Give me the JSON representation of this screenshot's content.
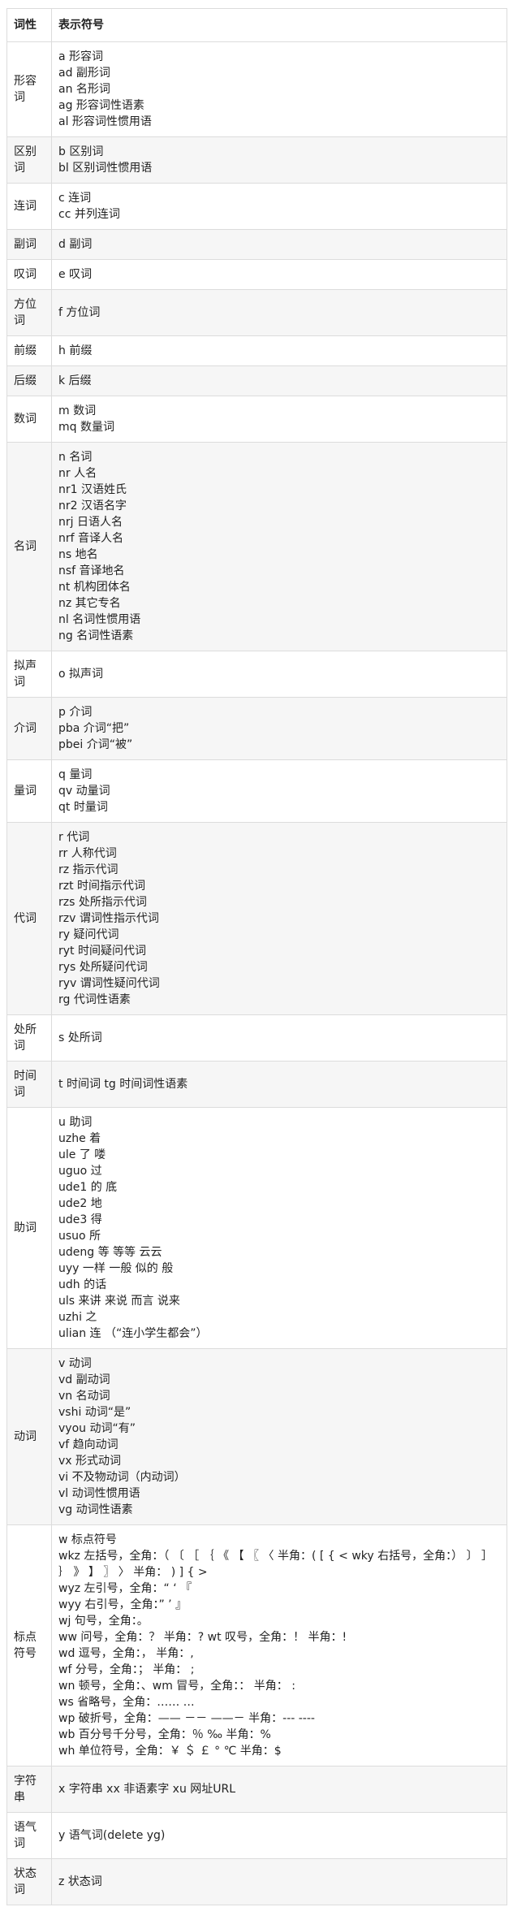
{
  "table": {
    "headers": [
      "词性",
      "表示符号"
    ],
    "rows": [
      {
        "pos": "形容词",
        "tags": [
          "a 形容词",
          "ad 副形词",
          "an 名形词",
          "ag 形容词性语素",
          "al 形容词性惯用语"
        ]
      },
      {
        "pos": "区别词",
        "tags": [
          "b 区别词",
          "bl 区别词性惯用语"
        ]
      },
      {
        "pos": "连词",
        "tags": [
          "c 连词",
          "cc 并列连词"
        ]
      },
      {
        "pos": "副词",
        "tags": [
          "d 副词"
        ]
      },
      {
        "pos": "叹词",
        "tags": [
          "e 叹词"
        ]
      },
      {
        "pos": "方位词",
        "tags": [
          "f 方位词"
        ]
      },
      {
        "pos": "前缀",
        "tags": [
          "h 前缀"
        ]
      },
      {
        "pos": "后缀",
        "tags": [
          "k 后缀"
        ]
      },
      {
        "pos": "数词",
        "tags": [
          "m 数词",
          "mq 数量词"
        ]
      },
      {
        "pos": "名词",
        "tags": [
          "n 名词",
          "nr 人名",
          "nr1 汉语姓氏",
          "nr2 汉语名字",
          "nrj 日语人名",
          "nrf 音译人名",
          "ns 地名",
          "nsf 音译地名",
          "nt 机构团体名",
          "nz 其它专名",
          "nl 名词性惯用语",
          "ng 名词性语素"
        ]
      },
      {
        "pos": "拟声词",
        "tags": [
          "o 拟声词"
        ]
      },
      {
        "pos": "介词",
        "tags": [
          "p 介词",
          "pba 介词“把”",
          "pbei 介词“被”"
        ]
      },
      {
        "pos": "量词",
        "tags": [
          "q 量词",
          "qv 动量词",
          "qt 时量词"
        ]
      },
      {
        "pos": "代词",
        "tags": [
          "r 代词",
          "rr 人称代词",
          "rz 指示代词",
          "rzt 时间指示代词",
          "rzs 处所指示代词",
          "rzv 谓词性指示代词",
          "ry 疑问代词",
          "ryt 时间疑问代词",
          "rys 处所疑问代词",
          "ryv 谓词性疑问代词",
          "rg 代词性语素"
        ]
      },
      {
        "pos": "处所词",
        "tags": [
          "s 处所词"
        ]
      },
      {
        "pos": "时间词",
        "tags": [
          "t 时间词 tg 时间词性语素"
        ]
      },
      {
        "pos": "助词",
        "tags": [
          "u 助词",
          "uzhe 着",
          "ule 了 喽",
          "uguo 过",
          "ude1 的 底",
          "ude2 地",
          "ude3 得",
          "usuo 所",
          "udeng 等 等等 云云",
          "uyy 一样 一般 似的 般",
          "udh 的话",
          "uls 来讲 来说 而言 说来",
          "uzhi 之",
          "ulian 连 （“连小学生都会”）"
        ]
      },
      {
        "pos": "动词",
        "tags": [
          "v 动词",
          "vd 副动词",
          "vn 名动词",
          "vshi 动词“是”",
          "vyou 动词“有”",
          "vf 趋向动词",
          "vx 形式动词",
          "vi 不及物动词（内动词）",
          "vl 动词性惯用语",
          "vg 动词性语素"
        ]
      },
      {
        "pos": "标点符号",
        "tags": [
          "w 标点符号",
          "wkz 左括号，全角：（ 〔 ［ ｛ 《 【 〖 〈 半角：( [ { < wky 右括号，全角：） 〕 ］ ｝ 》 】 〗 〉 半角： ) ] { >",
          "wyz 左引号，全角：“ ‘ 『",
          "wyy 右引号，全角：” ’ 』",
          "wj 句号，全角：。",
          "ww 问号，全角：？ 半角：? wt 叹号，全角：！ 半角：!",
          "wd 逗号，全角：， 半角：,",
          "wf 分号，全角：； 半角： ;",
          "wn 顿号，全角：、wm 冒号，全角：： 半角： :",
          "ws 省略号，全角：…… …",
          "wp 破折号，全角：—— －－ ——－ 半角：--- ----",
          "wb 百分号千分号，全角：％ ‰ 半角：%",
          "wh 单位符号，全角：￥ ＄ ￡ ° ℃ 半角：$"
        ]
      },
      {
        "pos": "字符串",
        "tags": [
          "x 字符串 xx 非语素字 xu 网址URL"
        ]
      },
      {
        "pos": "语气词",
        "tags": [
          "y 语气词(delete yg)"
        ]
      },
      {
        "pos": "状态词",
        "tags": [
          "z 状态词"
        ]
      }
    ]
  }
}
